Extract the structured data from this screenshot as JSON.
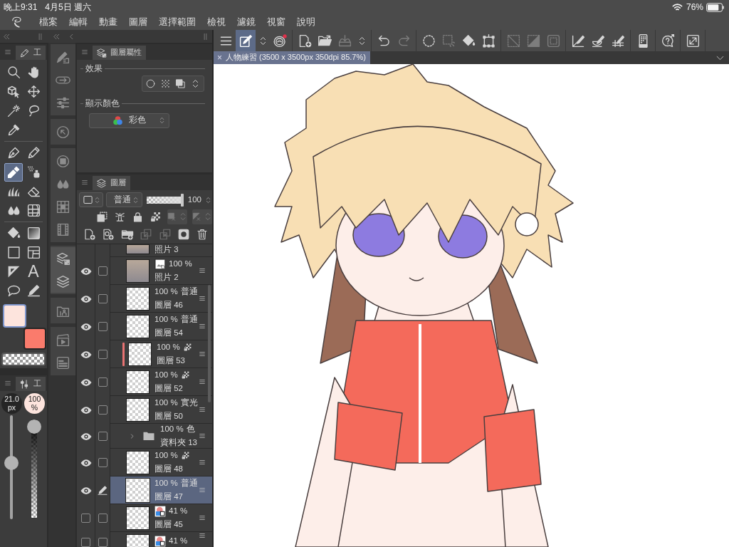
{
  "status_bar": {
    "time": "晚上9:31",
    "date": "4月5日 週六",
    "battery": "76%"
  },
  "menu_bar": {
    "items": [
      "檔案",
      "編輯",
      "動畫",
      "圖層",
      "選擇範圍",
      "檢視",
      "濾鏡",
      "視窗",
      "說明"
    ]
  },
  "tool_panel": {
    "tab_label": "工",
    "groups": [
      [
        {
          "kind": "magnifier",
          "selected": false
        },
        {
          "kind": "hand",
          "selected": false
        },
        {
          "kind": "cube-cursor",
          "selected": false
        },
        {
          "kind": "move-arrows",
          "selected": false
        },
        {
          "kind": "magic-wand",
          "selected": false
        },
        {
          "kind": "lasso",
          "selected": false
        },
        {
          "kind": "eyedropper",
          "selected": false
        }
      ],
      [
        {
          "kind": "pen-nib",
          "selected": false
        },
        {
          "kind": "pencil",
          "selected": false
        },
        {
          "kind": "marker",
          "selected": true
        },
        {
          "kind": "spray",
          "selected": false
        },
        {
          "kind": "grass",
          "selected": false
        },
        {
          "kind": "eraser",
          "selected": false
        },
        {
          "kind": "droplets",
          "selected": false
        },
        {
          "kind": "mesh",
          "selected": false
        }
      ],
      [
        {
          "kind": "bucket",
          "selected": false
        },
        {
          "kind": "gradient",
          "selected": false
        },
        {
          "kind": "rectangle",
          "selected": false
        },
        {
          "kind": "frame",
          "selected": false
        },
        {
          "kind": "triangle-ruler",
          "selected": false
        },
        {
          "kind": "text",
          "glyph": "A",
          "selected": false
        },
        {
          "kind": "speech-balloon",
          "selected": false
        },
        {
          "kind": "pen-line",
          "selected": false
        }
      ]
    ],
    "colors": [
      {
        "kind": "main",
        "color": "#fde4dd",
        "selected": true
      },
      {
        "kind": "sub",
        "color": "#fa7b6c",
        "selected": false
      },
      {
        "kind": "transparent",
        "selected": false
      }
    ]
  },
  "tool_property": {
    "tab_label": "工",
    "size": {
      "value": "21.0",
      "unit": "px",
      "level": 0.55
    },
    "opacity": {
      "value": "100",
      "unit": "%",
      "level": 1
    }
  },
  "dock": {
    "groups": [
      [
        {
          "kind": "pen-layers",
          "selected": false
        },
        {
          "kind": "cloud-arrow",
          "selected": false
        },
        {
          "kind": "sliders",
          "selected": false
        }
      ],
      [
        {
          "kind": "circle-arrow",
          "selected": false
        }
      ],
      [
        {
          "kind": "circle-square",
          "selected": false
        },
        {
          "kind": "droplets",
          "selected": false
        },
        {
          "kind": "grid-dots",
          "selected": false
        },
        {
          "kind": "film",
          "selected": false
        }
      ],
      [
        {
          "kind": "layers-squares",
          "selected": true
        },
        {
          "kind": "layers",
          "selected": true
        }
      ],
      [
        {
          "kind": "folder-figure",
          "selected": false
        }
      ],
      [
        {
          "kind": "clapboard",
          "selected": false
        },
        {
          "kind": "panel-bars",
          "selected": false
        }
      ]
    ]
  },
  "layer_property": {
    "tab_label": "圖層屬性",
    "effect_label": "效果",
    "display_color_label": "顯示顏色",
    "display_color": "彩色"
  },
  "layer_panel": {
    "tab_label": "圖層",
    "blend_mode": "普通",
    "opacity": {
      "value": "100",
      "level": 1
    },
    "top_cut_layer": {
      "name": "照片 3"
    },
    "layers": [
      {
        "kind": "photo",
        "opacity": "100 %",
        "name": "照片 2",
        "visible": true,
        "checked": false,
        "target": false,
        "selected": false,
        "alpha_locked": false
      },
      {
        "kind": "raster",
        "opacity": "100 %",
        "blend": "普通",
        "name": "圖層 46",
        "visible": true,
        "checked": false,
        "target": false,
        "selected": false,
        "alpha_locked": false
      },
      {
        "kind": "raster",
        "opacity": "100 %",
        "blend": "普通",
        "name": "圖層 54",
        "visible": true,
        "checked": false,
        "target": false,
        "selected": false,
        "alpha_locked": false
      },
      {
        "kind": "raster",
        "opacity": "100 %",
        "name": "圖層 53",
        "visible": true,
        "checked": false,
        "target": false,
        "selected": false,
        "alpha_locked": true,
        "color": "#e87272"
      },
      {
        "kind": "raster",
        "opacity": "100 %",
        "name": "圖層 52",
        "visible": true,
        "checked": false,
        "target": false,
        "selected": false,
        "alpha_locked": true
      },
      {
        "kind": "raster",
        "opacity": "100 %",
        "blend": "實光",
        "name": "圖層 50",
        "visible": true,
        "checked": false,
        "target": false,
        "selected": false,
        "alpha_locked": false
      },
      {
        "kind": "folder",
        "opacity": "100 %",
        "blend": "色",
        "name": "資料夾 13",
        "visible": true,
        "checked": false,
        "target": false,
        "selected": false,
        "alpha_locked": false,
        "expanded": false
      },
      {
        "kind": "raster",
        "opacity": "100 %",
        "name": "圖層 48",
        "visible": true,
        "checked": false,
        "target": false,
        "selected": false,
        "alpha_locked": true
      },
      {
        "kind": "raster",
        "opacity": "100 %",
        "blend": "普通",
        "name": "圖層 47",
        "visible": true,
        "target": true,
        "selected": true,
        "alpha_locked": false
      },
      {
        "kind": "tone",
        "opacity": "41 %",
        "name": "圖層 45",
        "visible": false,
        "checked": false,
        "target": false,
        "selected": false,
        "alpha_locked": false
      },
      {
        "kind": "tone",
        "opacity": "41 %",
        "visible": false,
        "checked": false,
        "target": false,
        "selected": false,
        "alpha_locked": false
      }
    ]
  },
  "toolbar": {
    "groups": [
      [
        {
          "kind": "menu",
          "selected": false,
          "disabled": false
        },
        {
          "kind": "pen-square",
          "selected": true,
          "disabled": false
        },
        {
          "kind": "up-down-chevron",
          "selected": false,
          "disabled": false
        },
        {
          "kind": "spiral",
          "selected": false,
          "disabled": false
        }
      ],
      [
        {
          "kind": "page-plus",
          "selected": false,
          "disabled": false
        },
        {
          "kind": "folder-open",
          "selected": false,
          "disabled": false
        },
        {
          "kind": "tray-arrow",
          "selected": false,
          "disabled": true
        },
        {
          "kind": "up-down-chevron",
          "selected": false,
          "disabled": false
        }
      ],
      [
        {
          "kind": "undo-arrow",
          "selected": false,
          "disabled": false
        },
        {
          "kind": "redo-arrow",
          "selected": false,
          "disabled": true
        }
      ],
      [
        {
          "kind": "dotted-circle",
          "selected": false,
          "disabled": false
        },
        {
          "kind": "dotted-square",
          "selected": false,
          "disabled": true
        },
        {
          "kind": "bucket",
          "selected": false,
          "disabled": false
        },
        {
          "kind": "transform-box",
          "selected": false,
          "disabled": false
        }
      ],
      [
        {
          "kind": "crossed-square",
          "selected": false,
          "disabled": true
        },
        {
          "kind": "half-square",
          "selected": false,
          "disabled": true
        },
        {
          "kind": "rounded-square",
          "selected": false,
          "disabled": true
        }
      ],
      [
        {
          "kind": "ruler-pen",
          "selected": false,
          "disabled": false
        },
        {
          "kind": "bowl-pen",
          "selected": false,
          "disabled": false
        },
        {
          "kind": "grid-pen",
          "selected": false,
          "disabled": false
        }
      ],
      [
        {
          "kind": "device",
          "selected": false,
          "disabled": false
        }
      ],
      [
        {
          "kind": "help-bubble",
          "selected": false,
          "disabled": false
        }
      ],
      [
        {
          "kind": "expand-box",
          "selected": false,
          "disabled": false
        }
      ]
    ]
  },
  "document_tab": {
    "close": "×",
    "title": "人物練習 (3500 x 3500px 350dpi 85.7%)"
  }
}
